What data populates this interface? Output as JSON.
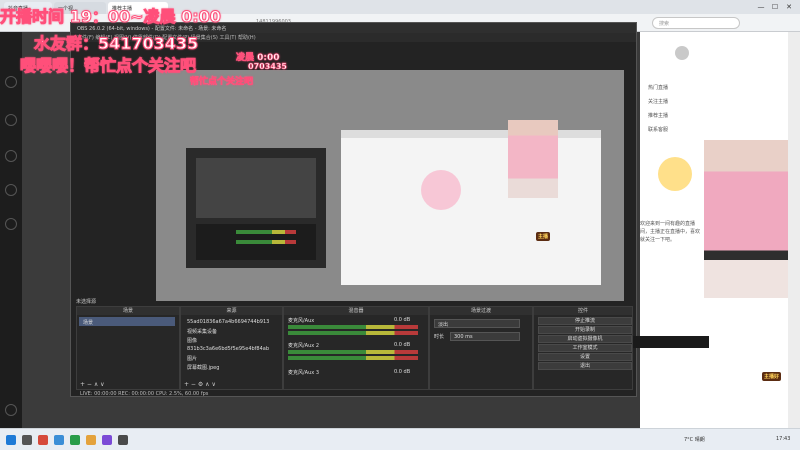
{
  "browser": {
    "tabs": [
      {
        "label": "抖音直播"
      },
      {
        "label": "一个视..."
      },
      {
        "label": "推荐主播"
      }
    ],
    "search_placeholder": "搜索",
    "address_hint": "14811996003",
    "win_controls": [
      "—",
      "☐",
      "✕"
    ]
  },
  "overlays": {
    "time_banner": "开播时间 19：00~凌晨 0:00",
    "qq_banner": "水友群：541703435",
    "cta_banner": "嘤嘤嘤！帮忙点个关注吧",
    "inner_time": "凌晨 0:00",
    "inner_qq": "0703435",
    "inner_cta": "帮忙点个关注吧"
  },
  "obs": {
    "title": "OBS 26.0.2 (64-bit, windows) - 配置文件: 未命名 - 场景: 未命名",
    "menu": "文件(F)  编辑(E)  视图(V)  停靠部件(D)  配置文件(P)  场景集合(S)  工具(T)  帮助(H)",
    "scene_label": "未选择源",
    "scenes_header": "场景",
    "scenes": [
      "场景"
    ],
    "sources_header": "来源",
    "sources": [
      "55ad01836a67a4b6694744b913",
      "视频采集设备",
      "图像",
      "831b3c3a6e6bd5f5e95e4bf84ab",
      "图片",
      "屏幕截图.jpeg"
    ],
    "mixer_header": "混音器",
    "mixer": [
      {
        "name": "麦克风/Aux",
        "db": "0.0 dB"
      },
      {
        "name": "麦克风/Aux 2",
        "db": "0.0 dB"
      },
      {
        "name": "麦克风/Aux 3",
        "db": "0.0 dB"
      }
    ],
    "transitions_header": "场景过渡",
    "transition_type": "淡出",
    "duration_label": "时长",
    "duration_value": "300 ms",
    "controls_header": "控件",
    "controls": [
      "停止推流",
      "开始录制",
      "启动虚拟摄像机",
      "工作室模式",
      "设置",
      "退出"
    ],
    "status": "LIVE: 00:00:00    REC: 00:00:00    CPU: 2.5%, 60.00 fps"
  },
  "right_panel": {
    "rows": [
      "热门直播",
      "关注主播",
      "推荐主播",
      "联系客服"
    ],
    "text_block": "欢迎来到一间有趣的直播间，主播正在直播中，喜欢就关注一下吧。"
  },
  "badges": {
    "badge_1": "主播",
    "badge_2": "主播好"
  },
  "taskbar": {
    "weather": "7°C 晴朗",
    "time": "17:43"
  }
}
